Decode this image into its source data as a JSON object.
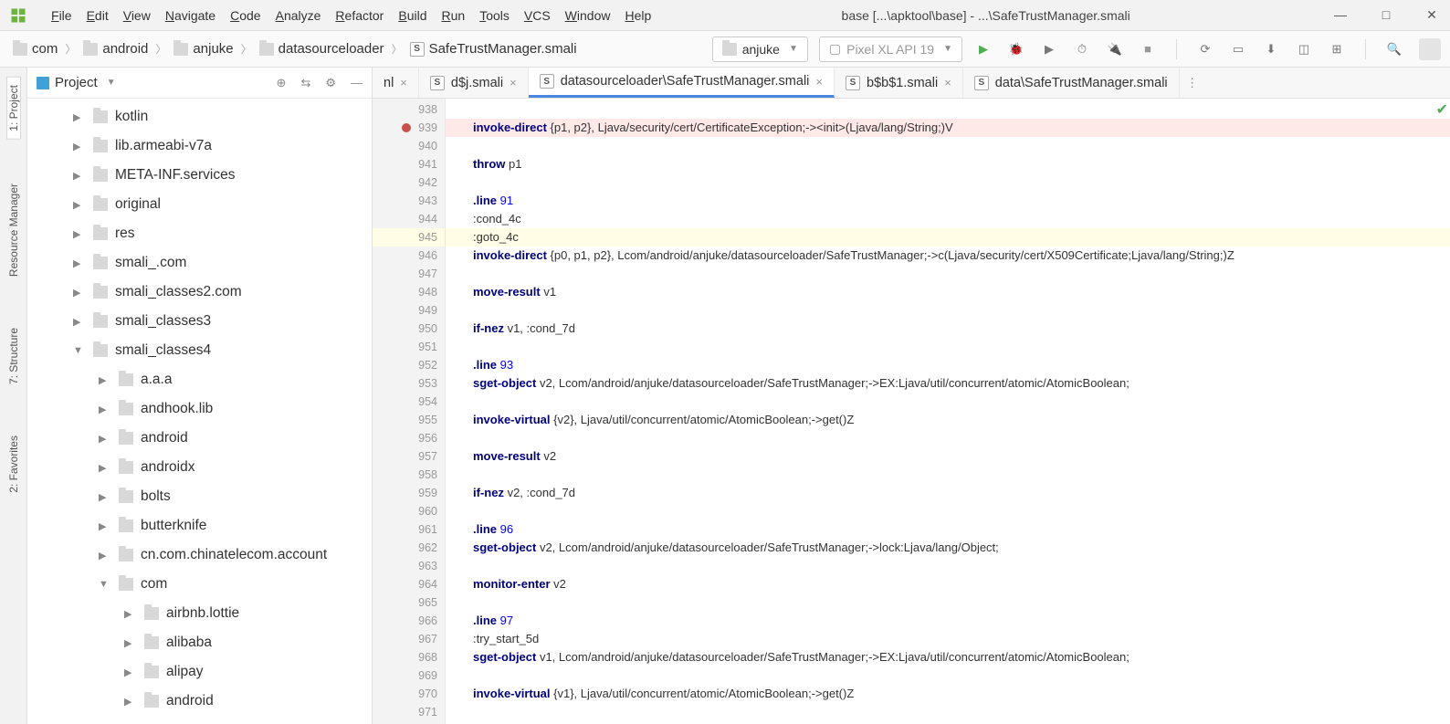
{
  "title": "base [...\\apktool\\base] - ...\\SafeTrustManager.smali",
  "menu": [
    "File",
    "Edit",
    "View",
    "Navigate",
    "Code",
    "Analyze",
    "Refactor",
    "Build",
    "Run",
    "Tools",
    "VCS",
    "Window",
    "Help"
  ],
  "breadcrumb": [
    {
      "icon": "dir",
      "name": "com"
    },
    {
      "icon": "dir",
      "name": "android"
    },
    {
      "icon": "dir",
      "name": "anjuke"
    },
    {
      "icon": "dir",
      "name": "datasourceloader"
    },
    {
      "icon": "smali",
      "name": "SafeTrustManager.smali"
    }
  ],
  "module": "anjuke",
  "device": "Pixel XL API 19",
  "panel_title": "Project",
  "side_tabs": [
    "1: Project",
    "Resource Manager",
    "7: Structure",
    "2: Favorites"
  ],
  "tree": [
    {
      "indent": 0,
      "arrow": "right",
      "name": "kotlin"
    },
    {
      "indent": 0,
      "arrow": "right",
      "name": "lib.armeabi-v7a"
    },
    {
      "indent": 0,
      "arrow": "right",
      "name": "META-INF.services"
    },
    {
      "indent": 0,
      "arrow": "right",
      "name": "original"
    },
    {
      "indent": 0,
      "arrow": "right",
      "name": "res"
    },
    {
      "indent": 0,
      "arrow": "right",
      "name": "smali_.com"
    },
    {
      "indent": 0,
      "arrow": "right",
      "name": "smali_classes2.com"
    },
    {
      "indent": 0,
      "arrow": "right",
      "name": "smali_classes3"
    },
    {
      "indent": 0,
      "arrow": "down",
      "name": "smali_classes4"
    },
    {
      "indent": 1,
      "arrow": "right",
      "name": "a.a.a"
    },
    {
      "indent": 1,
      "arrow": "right",
      "name": "andhook.lib"
    },
    {
      "indent": 1,
      "arrow": "right",
      "name": "android"
    },
    {
      "indent": 1,
      "arrow": "right",
      "name": "androidx"
    },
    {
      "indent": 1,
      "arrow": "right",
      "name": "bolts"
    },
    {
      "indent": 1,
      "arrow": "right",
      "name": "butterknife"
    },
    {
      "indent": 1,
      "arrow": "right",
      "name": "cn.com.chinatelecom.account"
    },
    {
      "indent": 1,
      "arrow": "down",
      "name": "com"
    },
    {
      "indent": 2,
      "arrow": "right",
      "name": "airbnb.lottie"
    },
    {
      "indent": 2,
      "arrow": "right",
      "name": "alibaba"
    },
    {
      "indent": 2,
      "arrow": "right",
      "name": "alipay"
    },
    {
      "indent": 2,
      "arrow": "right",
      "name": "android"
    }
  ],
  "tabs": [
    {
      "label": "nl",
      "icon": "none",
      "active": false,
      "close": true
    },
    {
      "label": "d$j.smali",
      "icon": "smali",
      "active": false,
      "close": true
    },
    {
      "label": "datasourceloader\\SafeTrustManager.smali",
      "icon": "smali",
      "active": true,
      "close": true
    },
    {
      "label": "b$b$1.smali",
      "icon": "smali",
      "active": false,
      "close": true
    },
    {
      "label": "data\\SafeTrustManager.smali",
      "icon": "smali",
      "active": false,
      "close": false
    }
  ],
  "lines": [
    {
      "n": 938,
      "bg": "",
      "html": ""
    },
    {
      "n": 939,
      "bg": "err",
      "bp": true,
      "html": "<span class='kw'>invoke-direct</span> {p1, p2}, Ljava/security/cert/CertificateException;-&gt;&lt;init&gt;(Ljava/lang/String;)V"
    },
    {
      "n": 940,
      "bg": "",
      "html": ""
    },
    {
      "n": 941,
      "bg": "",
      "html": "<span class='kw'>throw</span> p1"
    },
    {
      "n": 942,
      "bg": "",
      "html": ""
    },
    {
      "n": 943,
      "bg": "",
      "html": "<span class='kw'>.line</span> <span class='num'>91</span>"
    },
    {
      "n": 944,
      "bg": "",
      "html": ":cond_4c"
    },
    {
      "n": 945,
      "bg": "cur",
      "html": ":goto_4c"
    },
    {
      "n": 946,
      "bg": "",
      "html": "<span class='kw'>invoke-direct</span> {p0, p1, p2}, Lcom/android/anjuke/datasourceloader/SafeTrustManager;-&gt;c(Ljava/security/cert/X509Certificate;Ljava/lang/String;)Z"
    },
    {
      "n": 947,
      "bg": "",
      "html": ""
    },
    {
      "n": 948,
      "bg": "",
      "html": "<span class='kw'>move-result</span> v1"
    },
    {
      "n": 949,
      "bg": "",
      "html": ""
    },
    {
      "n": 950,
      "bg": "",
      "html": "<span class='kw'>if-nez</span> v1, :cond_7d"
    },
    {
      "n": 951,
      "bg": "",
      "html": ""
    },
    {
      "n": 952,
      "bg": "",
      "html": "<span class='kw'>.line</span> <span class='num'>93</span>"
    },
    {
      "n": 953,
      "bg": "",
      "html": "<span class='kw'>sget-object</span> v2, Lcom/android/anjuke/datasourceloader/SafeTrustManager;-&gt;EX:Ljava/util/concurrent/atomic/AtomicBoolean;"
    },
    {
      "n": 954,
      "bg": "",
      "html": ""
    },
    {
      "n": 955,
      "bg": "",
      "html": "<span class='kw'>invoke-virtual</span> {v2}, Ljava/util/concurrent/atomic/AtomicBoolean;-&gt;get()Z"
    },
    {
      "n": 956,
      "bg": "",
      "html": ""
    },
    {
      "n": 957,
      "bg": "",
      "html": "<span class='kw'>move-result</span> v2"
    },
    {
      "n": 958,
      "bg": "",
      "html": ""
    },
    {
      "n": 959,
      "bg": "",
      "html": "<span class='kw'>if-nez</span> v2, :cond_7d"
    },
    {
      "n": 960,
      "bg": "",
      "html": ""
    },
    {
      "n": 961,
      "bg": "",
      "html": "<span class='kw'>.line</span> <span class='num'>96</span>"
    },
    {
      "n": 962,
      "bg": "",
      "html": "<span class='kw'>sget-object</span> v2, Lcom/android/anjuke/datasourceloader/SafeTrustManager;-&gt;lock:Ljava/lang/Object;"
    },
    {
      "n": 963,
      "bg": "",
      "html": ""
    },
    {
      "n": 964,
      "bg": "",
      "html": "<span class='kw'>monitor-enter</span> v2"
    },
    {
      "n": 965,
      "bg": "",
      "html": ""
    },
    {
      "n": 966,
      "bg": "",
      "html": "<span class='kw'>.line</span> <span class='num'>97</span>"
    },
    {
      "n": 967,
      "bg": "",
      "html": ":try_start_5d"
    },
    {
      "n": 968,
      "bg": "",
      "html": "<span class='kw'>sget-object</span> v1, Lcom/android/anjuke/datasourceloader/SafeTrustManager;-&gt;EX:Ljava/util/concurrent/atomic/AtomicBoolean;"
    },
    {
      "n": 969,
      "bg": "",
      "html": ""
    },
    {
      "n": 970,
      "bg": "",
      "html": "<span class='kw'>invoke-virtual</span> {v1}, Ljava/util/concurrent/atomic/AtomicBoolean;-&gt;get()Z"
    },
    {
      "n": 971,
      "bg": "",
      "html": ""
    }
  ]
}
